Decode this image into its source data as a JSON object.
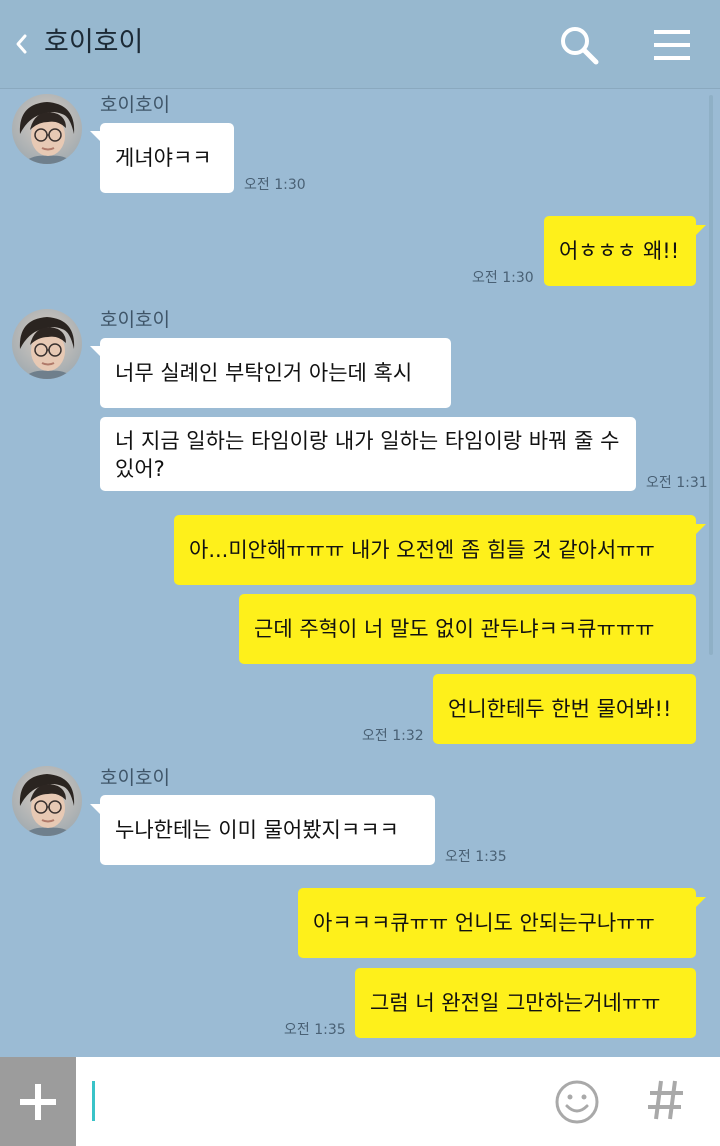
{
  "header": {
    "title": "호이호이",
    "icons": {
      "back": "chevron-left-icon",
      "search": "search-icon",
      "menu": "menu-icon"
    }
  },
  "messages": [
    {
      "sender": "호이호이",
      "direction": "in",
      "texts": [
        "게녀야ㅋㅋ"
      ],
      "time": "오전 1:30"
    },
    {
      "direction": "out",
      "texts": [
        "어ㅎㅎㅎ 왜!!"
      ],
      "time": "오전 1:30"
    },
    {
      "sender": "호이호이",
      "direction": "in",
      "texts": [
        "너무 실례인 부탁인거 아는데 혹시",
        "너 지금 일하는 타임이랑 내가 일하는 타임이랑 바꿔 줄 수 있어?"
      ],
      "time": "오전 1:31"
    },
    {
      "direction": "out",
      "texts": [
        "아...미안해ㅠㅠㅠ 내가 오전엔 좀 힘들 것 같아서ㅠㅠ",
        "근데 주혁이 너 말도 없이 관두냐ㅋㅋ큐ㅠㅠㅠ",
        "언니한테두 한번 물어봐!!"
      ],
      "time": "오전 1:32"
    },
    {
      "sender": "호이호이",
      "direction": "in",
      "texts": [
        "누나한테는 이미 물어봤지ㅋㅋㅋ"
      ],
      "time": "오전 1:35"
    },
    {
      "direction": "out",
      "texts": [
        "아ㅋㅋㅋ큐ㅠㅠ 언니도 안되는구나ㅠㅠ",
        "그럼 너 완전일 그만하는거네ㅠㅠ"
      ],
      "time": "오전 1:35"
    }
  ],
  "input": {
    "value": "",
    "placeholder": ""
  },
  "input_icons": {
    "plus": "plus-icon",
    "emoji": "smiley-icon",
    "hashtag": "hash-icon"
  },
  "colors": {
    "background": "#9bbbd4",
    "incoming_bubble": "#ffffff",
    "outgoing_bubble": "#fef01b",
    "cursor": "#39c3c8"
  }
}
